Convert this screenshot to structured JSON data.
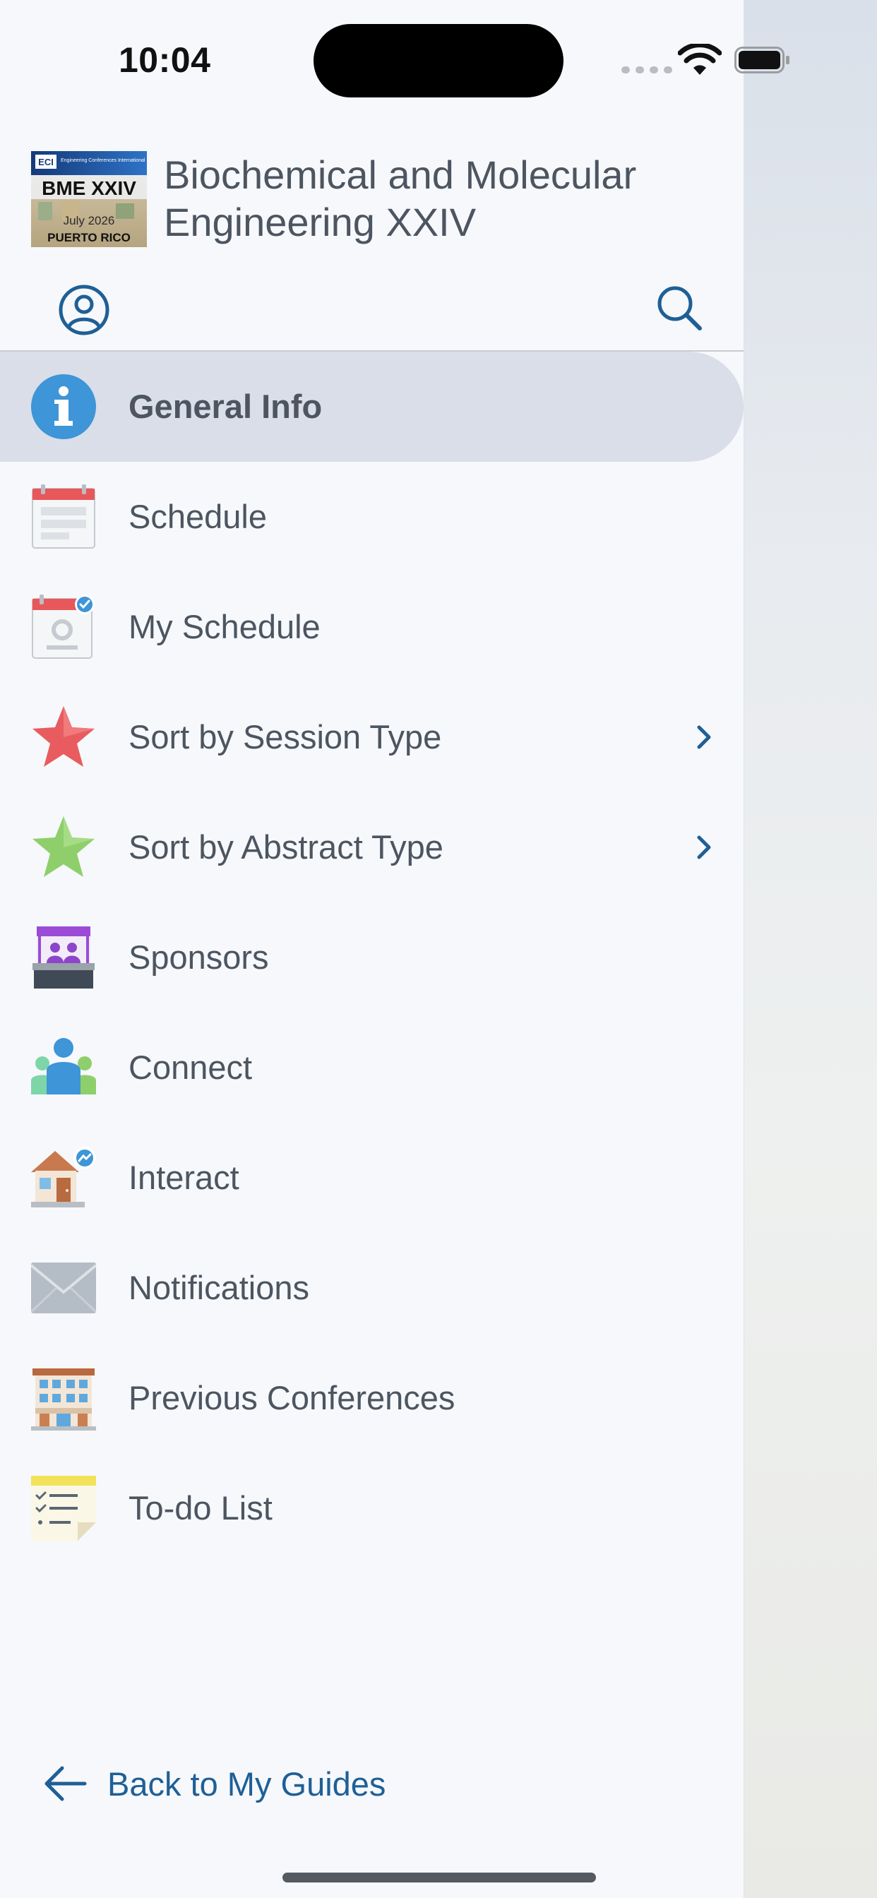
{
  "status_bar": {
    "time": "10:04"
  },
  "header": {
    "logo": {
      "brand": "ECI",
      "tagline": "Engineering Conferences International",
      "event": "BME XXIV",
      "date": "July 2026",
      "location": "PUERTO RICO"
    },
    "title": "Biochemical and Molecular Engineering XXIV"
  },
  "menu": {
    "items": [
      {
        "label": "General Info",
        "icon": "info-icon",
        "active": true,
        "has_submenu": false
      },
      {
        "label": "Schedule",
        "icon": "calendar-icon",
        "active": false,
        "has_submenu": false
      },
      {
        "label": "My Schedule",
        "icon": "my-calendar-icon",
        "active": false,
        "has_submenu": false
      },
      {
        "label": "Sort by Session Type",
        "icon": "red-star-icon",
        "active": false,
        "has_submenu": true
      },
      {
        "label": "Sort by Abstract Type",
        "icon": "green-star-icon",
        "active": false,
        "has_submenu": true
      },
      {
        "label": "Sponsors",
        "icon": "booth-icon",
        "active": false,
        "has_submenu": false
      },
      {
        "label": "Connect",
        "icon": "people-icon",
        "active": false,
        "has_submenu": false
      },
      {
        "label": "Interact",
        "icon": "house-chat-icon",
        "active": false,
        "has_submenu": false
      },
      {
        "label": "Notifications",
        "icon": "envelope-icon",
        "active": false,
        "has_submenu": false
      },
      {
        "label": "Previous Conferences",
        "icon": "building-icon",
        "active": false,
        "has_submenu": false
      },
      {
        "label": "To-do List",
        "icon": "checklist-icon",
        "active": false,
        "has_submenu": false
      }
    ]
  },
  "footer": {
    "back_label": "Back to My Guides"
  },
  "colors": {
    "accent": "#1f5f96",
    "text": "#4c5560",
    "active_bg": "#d9dee8",
    "drawer_bg": "#f6f8fb"
  }
}
